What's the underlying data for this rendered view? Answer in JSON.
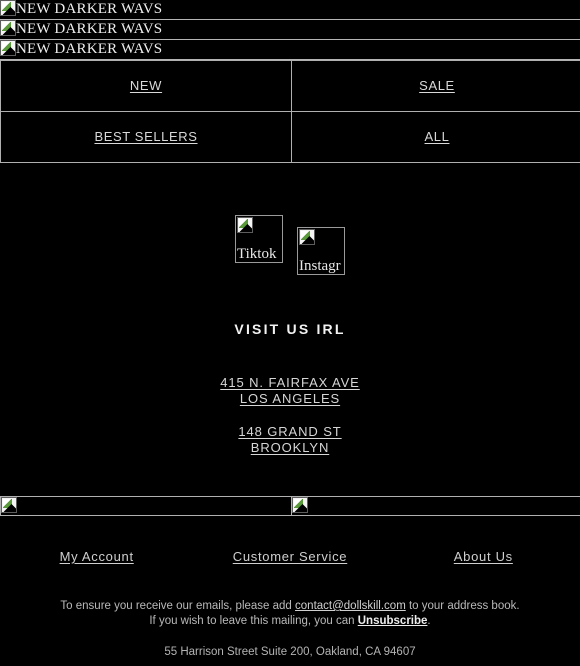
{
  "document": {
    "type": "marketing-email",
    "background_color": "#000000",
    "border_color": "#b0b0b0",
    "text_color": "#d8d8d8"
  },
  "banner": {
    "rows": [
      {
        "alt": "NEW DARKER WAVS",
        "icon": "broken-image-icon"
      },
      {
        "alt": "NEW DARKER WAVS",
        "icon": "broken-image-icon"
      },
      {
        "alt": "NEW DARKER WAVS",
        "icon": "broken-image-icon"
      }
    ]
  },
  "nav": {
    "items": [
      {
        "label": "NEW"
      },
      {
        "label": "SALE"
      },
      {
        "label": "BEST SELLERS"
      },
      {
        "label": "ALL"
      }
    ]
  },
  "social": {
    "items": [
      {
        "alt": "Tiktok",
        "icon": "broken-image-icon"
      },
      {
        "alt": "Instagr",
        "icon": "broken-image-icon"
      }
    ]
  },
  "visit": {
    "heading": "VISIT US IRL",
    "locations": [
      {
        "line1": "415 N. FAIRFAX AVE",
        "line2": "LOS ANGELES"
      },
      {
        "line1": "148 GRAND ST",
        "line2": "BROOKLYN"
      }
    ]
  },
  "lower_images": [
    {
      "alt": "",
      "icon": "broken-image-icon"
    },
    {
      "alt": "",
      "icon": "broken-image-icon"
    }
  ],
  "footer": {
    "links": [
      {
        "label": "My Account"
      },
      {
        "label": "Customer Service"
      },
      {
        "label": "About Us"
      }
    ]
  },
  "legal": {
    "line1_before": "To ensure you receive our emails, please add ",
    "email": "contact@dollskill.com",
    "line1_after": " to your address book.",
    "line2_before": "If you wish to leave this mailing, you can ",
    "unsubscribe": "Unsubscribe",
    "line2_after": ".",
    "address": "55 Harrison Street Suite 200, Oakland, CA 94607"
  }
}
